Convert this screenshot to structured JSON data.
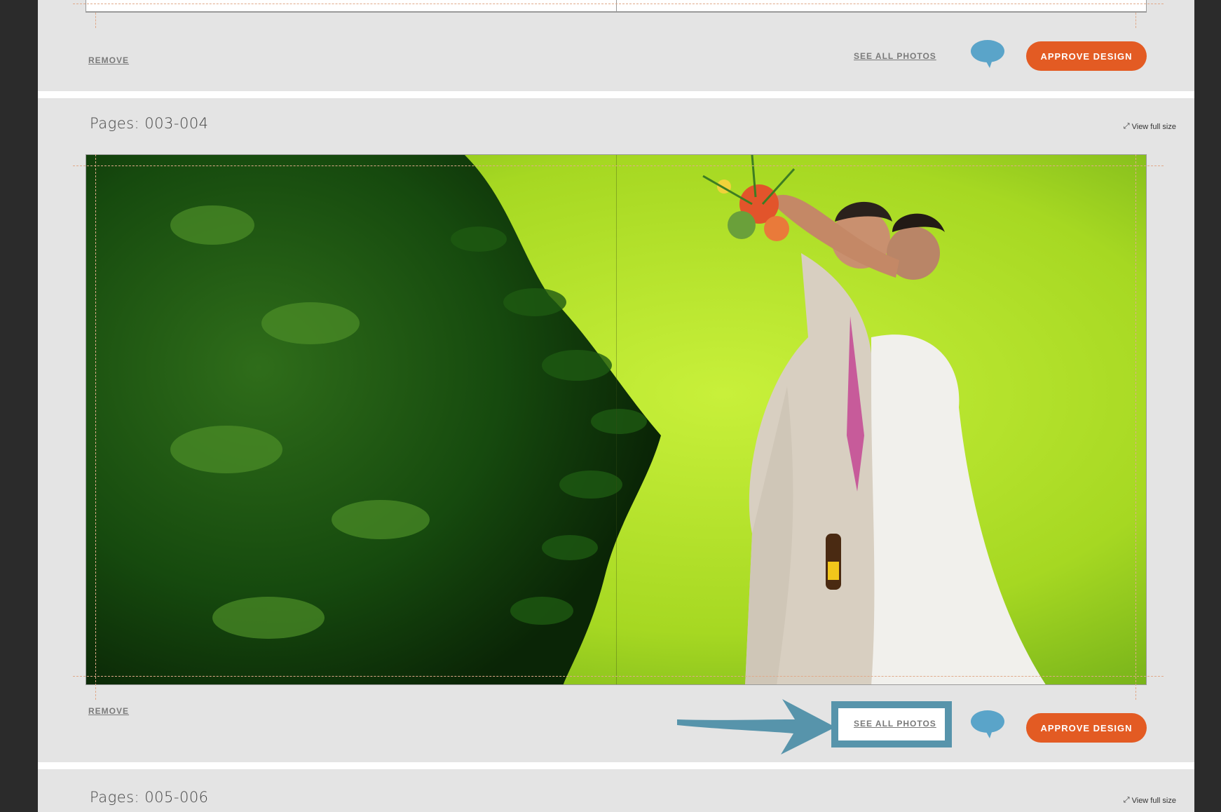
{
  "colors": {
    "accent": "#e35b23",
    "annotation": "#5794ab",
    "comment_bubble": "#5aa4c9"
  },
  "top_section": {
    "remove_label": "REMOVE",
    "see_all_label": "SEE ALL PHOTOS",
    "approve_label": "APPROVE DESIGN",
    "comment_icon": "speech-bubble-icon"
  },
  "spread_1": {
    "title": "Pages: 003-004",
    "view_full_label": "View full size",
    "view_full_icon": "expand-arrow-icon",
    "remove_label": "REMOVE",
    "see_all_label": "SEE ALL PHOTOS",
    "approve_label": "APPROVE DESIGN",
    "comment_icon": "speech-bubble-icon"
  },
  "spread_2": {
    "title": "Pages: 005-006",
    "view_full_label": "View full size",
    "view_full_icon": "expand-arrow-icon"
  }
}
